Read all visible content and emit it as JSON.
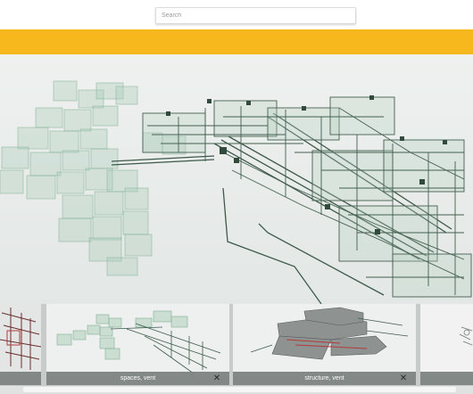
{
  "search": {
    "placeholder": "Search"
  },
  "colors": {
    "accent_bar": "#f6b81c",
    "pipe": "#3d5a4c",
    "volume": "#9fc7ae"
  },
  "thumbnails": [
    {
      "caption": "",
      "close_icon": "close-icon"
    },
    {
      "caption": "spaces, vent",
      "close_icon": "close-icon"
    },
    {
      "caption": "structure, vent",
      "close_icon": "close-icon"
    },
    {
      "caption": "",
      "close_icon": ""
    }
  ]
}
